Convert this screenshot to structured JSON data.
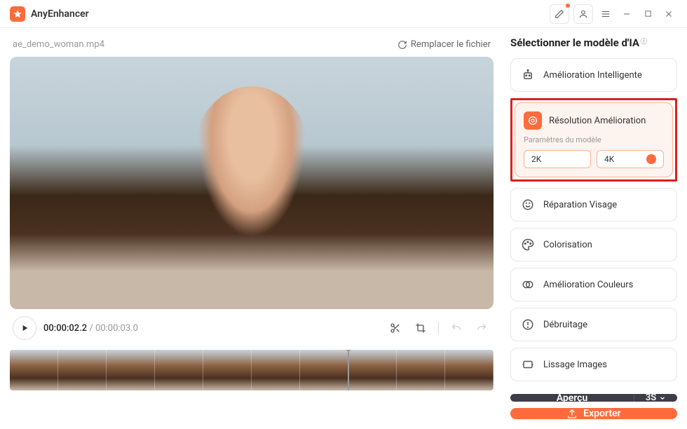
{
  "app": {
    "title": "AnyEnhancer"
  },
  "file": {
    "name": "ae_demo_woman.mp4",
    "replace_label": "Remplacer le fichier"
  },
  "playback": {
    "current": "00:00:02.2",
    "total": "00:00:03.0"
  },
  "panel": {
    "title": "Sélectionner le modèle d'IA",
    "params_label": "Paramètres du modèle",
    "param_options": [
      "2K",
      "4K"
    ],
    "items": [
      {
        "label": "Amélioration Intelligente"
      },
      {
        "label": "Résolution Amélioration"
      },
      {
        "label": "Réparation Visage"
      },
      {
        "label": "Colorisation"
      },
      {
        "label": "Amélioration Couleurs"
      },
      {
        "label": "Débruitage"
      },
      {
        "label": "Lissage Images"
      }
    ]
  },
  "actions": {
    "preview": "Aperçu",
    "preview_duration": "3S",
    "export": "Exporter"
  }
}
